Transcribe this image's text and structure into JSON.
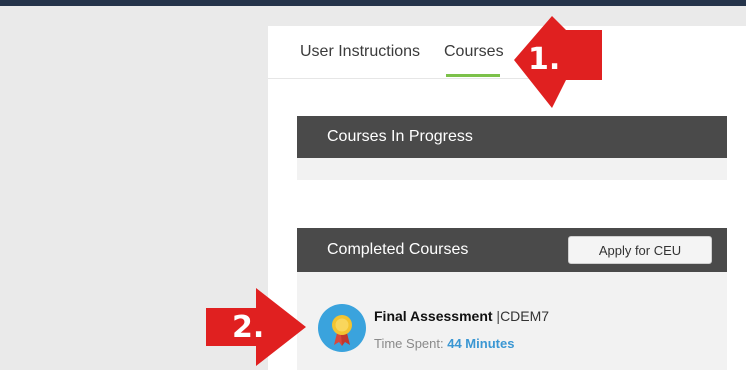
{
  "tabs": [
    {
      "label": "User Instructions"
    },
    {
      "label": "Courses"
    }
  ],
  "sections": {
    "in_progress": {
      "title": "Courses In Progress"
    },
    "completed": {
      "title": "Completed Courses",
      "apply_button": "Apply for CEU",
      "courses": [
        {
          "name": "Final Assessment",
          "separator": "|",
          "code": "CDEM7",
          "time_label": "Time Spent:",
          "time_value": "44 Minutes"
        }
      ]
    }
  },
  "annotations": {
    "arrow1": "1.",
    "arrow2": "2."
  },
  "colors": {
    "header_bg": "#4a4a4a",
    "tab_active_underline": "#7cc14a",
    "time_value": "#3b97d3",
    "annotation_arrow": "#e02020"
  },
  "icons": {
    "course_icon": "medal-icon"
  }
}
